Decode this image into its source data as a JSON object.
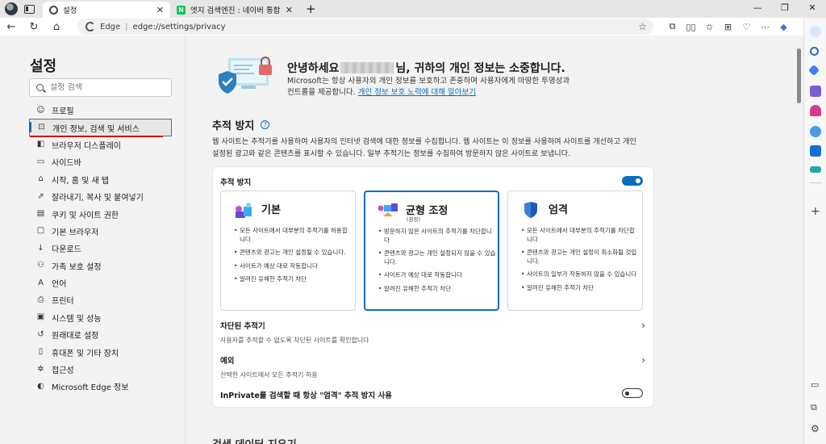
{
  "browser": {
    "tabs": [
      {
        "title": "설정",
        "active": true
      },
      {
        "title": "엣지 검색엔진 : 네이버 통합검색",
        "active": false
      }
    ],
    "address": {
      "brand": "Edge",
      "url": "edge://settings/privacy"
    }
  },
  "sidebar": {
    "title": "설정",
    "search_placeholder": "설정 검색",
    "items": [
      {
        "label": "프로필",
        "icon": "profile-icon"
      },
      {
        "label": "개인 정보, 검색 및 서비스",
        "icon": "lock-icon",
        "active": true
      },
      {
        "label": "브라우저 디스플레이",
        "icon": "appearance-icon"
      },
      {
        "label": "사이드바",
        "icon": "sidebar-icon"
      },
      {
        "label": "시작, 홈 및 새 탭",
        "icon": "home-icon"
      },
      {
        "label": "잘라내기, 복사 및 붙여넣기",
        "icon": "share-icon"
      },
      {
        "label": "쿠키 및 사이트 권한",
        "icon": "cookie-icon"
      },
      {
        "label": "기본 브라우저",
        "icon": "browser-icon"
      },
      {
        "label": "다운로드",
        "icon": "download-icon"
      },
      {
        "label": "가족 보호 설정",
        "icon": "family-icon"
      },
      {
        "label": "언어",
        "icon": "language-icon"
      },
      {
        "label": "프린터",
        "icon": "printer-icon"
      },
      {
        "label": "시스템 및 성능",
        "icon": "system-icon"
      },
      {
        "label": "원래대로 설정",
        "icon": "reset-icon"
      },
      {
        "label": "휴대폰 및 기타 장치",
        "icon": "phone-icon"
      },
      {
        "label": "접근성",
        "icon": "accessibility-icon"
      },
      {
        "label": "Microsoft Edge 정보",
        "icon": "edge-icon"
      }
    ]
  },
  "hero": {
    "greeting_pre": "안녕하세요",
    "greeting_post": "님, 귀하의 개인 정보는 소중합니다.",
    "description": "Microsoft는 항상 사용자의 개인 정보를 보호하고 존중하며 사용자에게 마땅한 투명성과 컨트롤을 제공합니다.",
    "link": "개인 정보 보호 노력에 대해 알아보기"
  },
  "tracking": {
    "title": "추적 방지",
    "description": "웹 사이트는 추적기를 사용하여 사용자의 인터넷 검색에 대한 정보를 수집합니다. 웹 사이트는 이 정보를 사용하여 사이트를 개선하고 개인 설정된 광고와 같은 콘텐츠를 표시할 수 있습니다. 일부 추적기는 정보를 수집하여 방문하지 않은 사이트로 보냅니다.",
    "toggle_label": "추적 방지",
    "enabled": true,
    "options": [
      {
        "title": "기본",
        "subtitle": "",
        "bullets": [
          "모든 사이트에서 대부분의 추적기를 허용합니다",
          "콘텐츠와 광고는 개인 설정될 수 있습니다.",
          "사이트가 예상 대로 작동합니다",
          "알려진 유해한 추적기 차단"
        ]
      },
      {
        "title": "균형 조정",
        "subtitle": "(권장)",
        "selected": true,
        "bullets": [
          "방문하지 않은 사이트의 추적기를 차단합니다",
          "콘텐츠와 광고는 개인 설정되지 않을 수 있습니다.",
          "사이트가 예상 대로 작동합니다",
          "알려진 유해한 추적기 차단"
        ]
      },
      {
        "title": "엄격",
        "subtitle": "",
        "bullets": [
          "모든 사이트에서 대부분의 추적기를 차단합니다",
          "콘텐츠와 광고는 개인 설정이 최소화될 것입니다.",
          "사이트의 일부가 작동하지 않을 수 있습니다",
          "알려진 유해한 추적기 차단"
        ]
      }
    ],
    "blocked": {
      "title": "차단된 추적기",
      "desc": "사용자를 추적할 수 없도록 차단된 사이트를 확인합니다"
    },
    "exceptions": {
      "title": "예외",
      "desc": "선택한 사이트에서 모든 추적기 허용"
    },
    "inprivate": {
      "label": "InPrivate를 검색할 때 항상 \"엄격\" 추적 방지 사용",
      "enabled": false
    }
  },
  "next_section": {
    "title": "검색 데이터 지우기"
  },
  "colors": {
    "accent": "#0f6cbd",
    "highlight": "#d0021b"
  }
}
